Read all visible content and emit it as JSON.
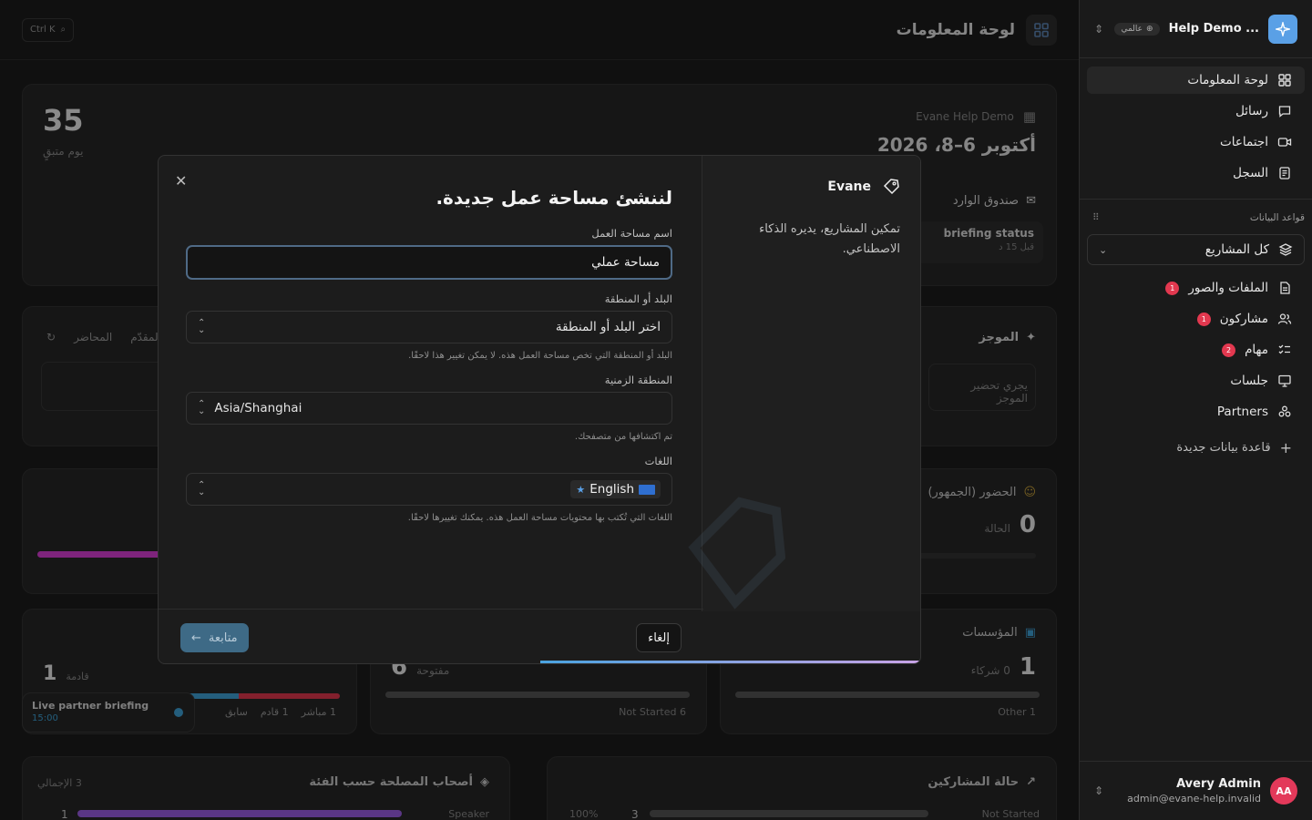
{
  "sidebar": {
    "org_name": "Help Demo ...",
    "scope_label": "عالمي",
    "nav": [
      {
        "label": "لوحة المعلومات",
        "icon": "dashboard-icon"
      },
      {
        "label": "رسائل",
        "icon": "message-icon"
      },
      {
        "label": "اجتماعات",
        "icon": "video-icon"
      },
      {
        "label": "السجل",
        "icon": "log-icon"
      }
    ],
    "databases_title": "قواعد البيانات",
    "project_select": "كل المشاريع",
    "databases": [
      {
        "label": "الملفات والصور",
        "badge": "1"
      },
      {
        "label": "مشاركون",
        "badge": "1"
      },
      {
        "label": "مهام",
        "badge": "2"
      },
      {
        "label": "جلسات",
        "badge": ""
      },
      {
        "label": "Partners",
        "badge": ""
      }
    ],
    "new_database": "قاعدة بيانات جديدة",
    "user": {
      "initials": "AA",
      "name": "Avery Admin",
      "email": "admin@evane-help.invalid"
    }
  },
  "main": {
    "title": "لوحة المعلومات",
    "shortcut": "Ctrl K",
    "event": {
      "org": "Evane Help Demo",
      "date": "أكتوبر 6–8، 2026"
    },
    "countdown": {
      "value": "35",
      "label": "يوم متبقٍ"
    },
    "inbox": {
      "title": "صندوق الوارد",
      "item": "briefing status",
      "time": "قبل 15 د"
    },
    "summary": {
      "title": "الموجز",
      "body": "يجري تحضير الموجز",
      "tab_speakers": "المحاضر",
      "tab_presenter": "المقدّم"
    },
    "attendance": {
      "title": "الحضور (الجمهور)",
      "value": "0",
      "sub": "الحالة"
    },
    "orgs": {
      "title": "المؤسسات",
      "value": "1",
      "sub": "0 شركاء",
      "legend": "1 Other"
    },
    "tasks": {
      "value": "6",
      "sub": "مفتوحة",
      "legend": "6 Not Started"
    },
    "sessions": {
      "value": "1",
      "sub": "قادمة",
      "legend": [
        "1 مباشر",
        "1 قادم",
        "سابق"
      ]
    },
    "live_toast": {
      "title": "Live partner briefing",
      "time": "15:00"
    },
    "stakeholders": {
      "title": "أصحاب المصلحة حسب الفئة",
      "total": "3 الإجمالي",
      "row_label": "Speaker",
      "row_value": "1"
    },
    "participants": {
      "title": "حالة المشاركين",
      "row_label": "Not Started",
      "row_value": "3",
      "row_pct": "100%"
    }
  },
  "modal": {
    "brand": "Evane",
    "brand_desc": "تمكين المشاريع، يديره الذكاء الاصطناعي.",
    "title": "لننشئ مساحة عمل جديدة.",
    "workspace_label": "اسم مساحة العمل",
    "workspace_value": "مساحة عملي",
    "country_label": "البلد أو المنطقة",
    "country_placeholder": "اختر البلد أو المنطقة",
    "country_help": "البلد أو المنطقة التي تخص مساحة العمل هذه. لا يمكن تغيير هذا لاحقًا.",
    "timezone_label": "المنطقة الزمنية",
    "timezone_value": "Asia/Shanghai",
    "timezone_help": "تم اكتشافها من متصفحك.",
    "languages_label": "اللغات",
    "language_chip": "English",
    "languages_help": "اللغات التي تُكتب بها محتويات مساحة العمل هذه. يمكنك تغييرها لاحقًا.",
    "cancel": "إلغاء",
    "next": "متابعة",
    "progress": 0.5
  },
  "colors": {
    "accent": "#5aa0e6",
    "badge": "#e2384f",
    "avatar": "#e3395a"
  }
}
